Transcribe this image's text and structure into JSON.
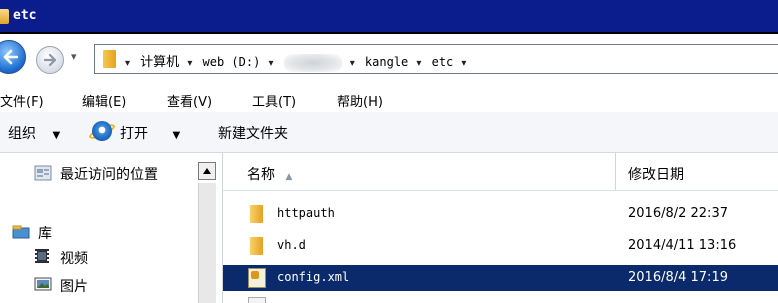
{
  "window": {
    "title": "etc"
  },
  "address": {
    "crumbs": [
      "计算机",
      "web (D:)",
      "kangle",
      "etc"
    ],
    "separator": "▾",
    "history_arrow": "▾"
  },
  "menu": {
    "items": [
      "文件(F)",
      "编辑(E)",
      "查看(V)",
      "工具(T)",
      "帮助(H)"
    ]
  },
  "commands": {
    "organize": "组织",
    "open": "打开",
    "new_folder": "新建文件夹",
    "dropdown": "▼"
  },
  "nav": {
    "recent": "最近访问的位置",
    "library": "库",
    "video": "视频",
    "pictures": "图片"
  },
  "columns": {
    "name": "名称",
    "modified": "修改日期",
    "sort_indicator": "▲"
  },
  "files": [
    {
      "name": "httpauth",
      "date": "2016/8/2 22:37",
      "type": "folder",
      "selected": false
    },
    {
      "name": "vh.d",
      "date": "2014/4/11 13:16",
      "type": "folder",
      "selected": false
    },
    {
      "name": "config.xml",
      "date": "2016/8/4 17:19",
      "type": "xml",
      "selected": true
    }
  ],
  "colors": {
    "titlebar": "#0b1d8c",
    "selection": "#0a2a6b"
  }
}
